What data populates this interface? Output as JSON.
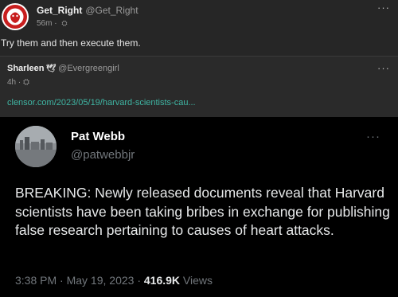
{
  "post": {
    "author_name": "Get_Right",
    "author_handle": "@Get_Right",
    "time": "56m",
    "separator": "·",
    "text": "Try them and then execute them.",
    "menu": "···"
  },
  "reply": {
    "author_name": "Sharleen",
    "bird": "🕊",
    "author_handle": "@Evergreengirl",
    "time": "4h",
    "separator": "·",
    "link": "clensor.com/2023/05/19/harvard-scientists-cau...",
    "menu": "···"
  },
  "embedded_tweet": {
    "name": "Pat Webb",
    "handle": "@patwebbjr",
    "menu": "···",
    "text": "BREAKING: Newly released documents reveal that Harvard scientists have been taking bribes in exchange for publishing false research pertaining to causes of heart attacks.",
    "time": "3:38 PM",
    "sep1": " · ",
    "date": "May 19, 2023",
    "sep2": " · ",
    "views_count": "416.9K",
    "views_label": " Views"
  }
}
